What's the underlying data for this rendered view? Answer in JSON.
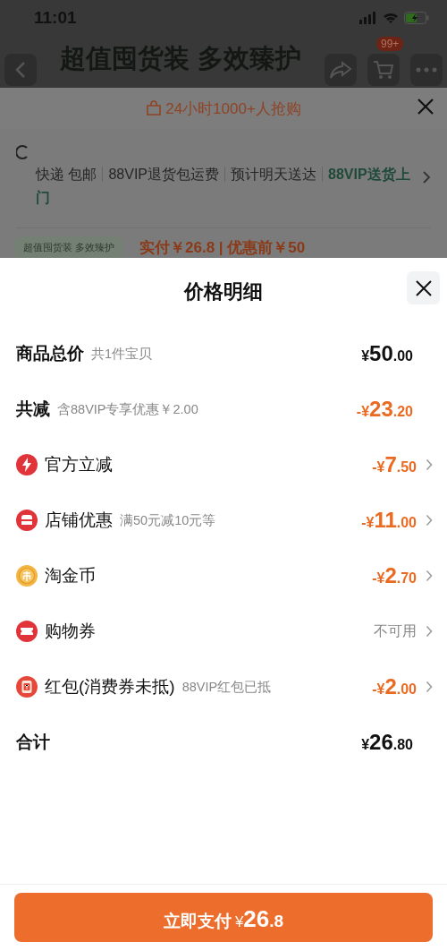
{
  "status_bar": {
    "time": "11:01"
  },
  "nav_bar": {
    "title": "超值囤货装 多效臻护",
    "cart_badge": "99+"
  },
  "banner": {
    "text": "24小时1000+人抢购"
  },
  "delivery": {
    "segments": [
      {
        "text": "快递 包邮",
        "highlight": false
      },
      {
        "text": "88VIP退货包运费",
        "highlight": false
      },
      {
        "text": "预计明天送达",
        "highlight": false
      },
      {
        "text": "88VIP送货上门",
        "highlight": true
      }
    ]
  },
  "promo_row": {
    "tag": "超值囤货装 多效臻护",
    "price_text": "实付￥26.8 | 优惠前￥50"
  },
  "sheet": {
    "title": "价格明细",
    "rows": [
      {
        "kind": "total",
        "label": "商品总价",
        "note": "共1件宝贝",
        "amount": {
          "prefix": "¥",
          "main": "50",
          "fraction": ".00"
        }
      },
      {
        "kind": "reduction",
        "label": "共减",
        "note": "含88VIP专享优惠￥2.00",
        "amount": {
          "prefix": "-¥",
          "main": "23",
          "fraction": ".20"
        }
      },
      {
        "kind": "lightning",
        "label": "官方立减",
        "amount": {
          "prefix": "-¥",
          "main": "7",
          "fraction": ".50"
        }
      },
      {
        "kind": "shop",
        "label": "店铺优惠",
        "note": "满50元减10元等",
        "amount": {
          "prefix": "-¥",
          "main": "11",
          "fraction": ".00"
        }
      },
      {
        "kind": "coin",
        "label": "淘金币",
        "amount": {
          "prefix": "-¥",
          "main": "2",
          "fraction": ".70"
        }
      },
      {
        "kind": "ticket",
        "label": "购物券",
        "value": "不可用"
      },
      {
        "kind": "envelope",
        "label": "红包(消费券未抵)",
        "note": "88VIP红包已抵",
        "amount": {
          "prefix": "-¥",
          "main": "2",
          "fraction": ".00"
        }
      },
      {
        "kind": "total",
        "label": "合计",
        "amount": {
          "prefix": "¥",
          "main": "26",
          "fraction": ".80"
        }
      }
    ]
  },
  "pay_button": {
    "label": "立即支付",
    "amount": {
      "prefix": "¥",
      "main": "26",
      "fraction": ".8"
    }
  }
}
